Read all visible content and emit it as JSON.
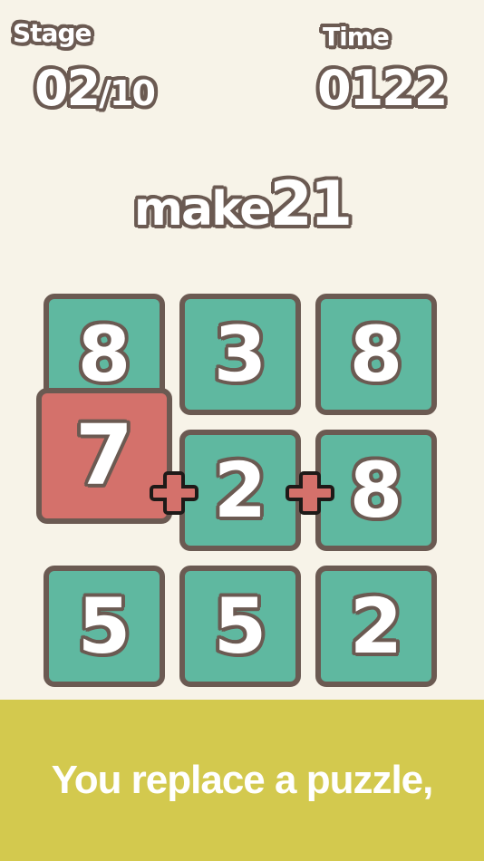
{
  "hud": {
    "stage_label": "Stage",
    "stage_current": "02",
    "stage_total": "/10",
    "time_label": "Time",
    "time_value": "0122"
  },
  "target": {
    "prefix": "make",
    "number": "21"
  },
  "grid": {
    "row1": [
      "8",
      "3",
      "8"
    ],
    "row2": [
      "7",
      "2",
      "8"
    ],
    "row3": [
      "5",
      "5",
      "2"
    ],
    "selected_tile": "7",
    "operators": [
      "+",
      "+"
    ]
  },
  "caption": "You replace a puzzle,",
  "colors": {
    "background": "#f7f3e8",
    "tile": "#5fb8a0",
    "tile_selected": "#d4716b",
    "outline": "#6b5a52",
    "operator": "#d4716b",
    "caption_bar": "#d3c94e"
  }
}
